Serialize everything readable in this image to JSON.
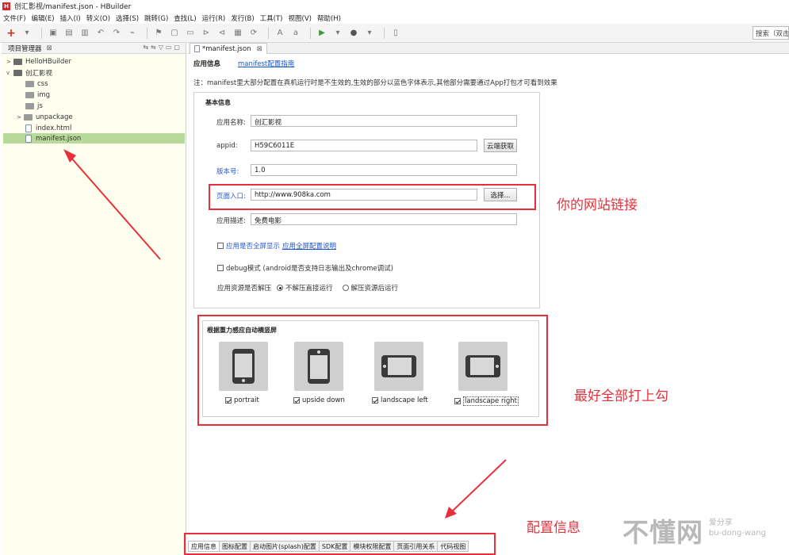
{
  "window": {
    "title": "创汇影视/manifest.json  -  HBuilder",
    "logo": "H"
  },
  "menu": [
    "文件(F)",
    "编辑(E)",
    "插入(I)",
    "转义(O)",
    "选择(S)",
    "跳转(G)",
    "查找(L)",
    "运行(R)",
    "发行(B)",
    "工具(T)",
    "视图(V)",
    "帮助(H)"
  ],
  "toolbar": {
    "search_value": "搜索（双击"
  },
  "project_panel": {
    "title": "项目管理器",
    "tree": [
      {
        "label": "HelloHBuilder",
        "arrow": ">",
        "icon": "project-icon"
      },
      {
        "label": "创汇影视",
        "arrow": "v",
        "icon": "project-icon"
      },
      {
        "label": "css",
        "arrow": "",
        "icon": "folder-icon"
      },
      {
        "label": "img",
        "arrow": "",
        "icon": "folder-icon"
      },
      {
        "label": "js",
        "arrow": "",
        "icon": "folder-icon"
      },
      {
        "label": "unpackage",
        "arrow": ">",
        "icon": "folder-icon"
      },
      {
        "label": "index.html",
        "arrow": "",
        "icon": "file-icon"
      },
      {
        "label": "manifest.json",
        "arrow": "",
        "icon": "file-icon"
      }
    ]
  },
  "editor": {
    "tab_label": "*manifest.json",
    "header_title": "应用信息",
    "header_link": "manifest配置指南",
    "note": "注：manifest里大部分配置在真机运行时是不生效的,生效的部分以蓝色字体表示,其他部分需要通过App打包才可看到效果"
  },
  "basic_info": {
    "title": "基本信息",
    "app_name_label": "应用名称:",
    "app_name_value": "创汇影视",
    "appid_label": "appid:",
    "appid_value": "H59C6011E",
    "cloud_btn": "云端获取",
    "version_label": "版本号:",
    "version_value": "1.0",
    "entry_label": "页面入口:",
    "entry_value": "http://www.908ka.com",
    "choose_btn": "选择...",
    "desc_label": "应用描述:",
    "desc_value": "免费电影",
    "fullscreen_label": "应用是否全屏显示",
    "fullscreen_link": "应用全屏配置说明",
    "debug_label": "debug模式 (android是否支持日志输出及chrome调试)",
    "extract_label": "应用资源是否解压",
    "extract_opt1": "不解压直接运行",
    "extract_opt2": "解压资源后运行"
  },
  "orientation": {
    "title": "根据重力感应自动横竖屏",
    "options": [
      {
        "label": "portrait",
        "icon": "portrait-phone-icon",
        "checked": true
      },
      {
        "label": "upside down",
        "icon": "upside-down-phone-icon",
        "checked": true
      },
      {
        "label": "landscape left",
        "icon": "landscape-left-phone-icon",
        "checked": true
      },
      {
        "label": "landscape right",
        "icon": "landscape-right-phone-icon",
        "checked": true
      }
    ]
  },
  "annotations": {
    "site_link": "你的网站链接",
    "check_all": "最好全部打上勾",
    "config_info": "配置信息"
  },
  "bottom_tabs": [
    "应用信息",
    "图标配置",
    "启动图片(splash)配置",
    "SDK配置",
    "模块权限配置",
    "页面引用关系",
    "代码视图"
  ],
  "watermark": {
    "big": "不懂网",
    "small_top": "爱分享",
    "small_bottom": "bu-dong-wang"
  },
  "colors": {
    "annotation_red": "#e8303a",
    "selection_green": "#b7d99a",
    "link_blue": "#1a55c8"
  }
}
